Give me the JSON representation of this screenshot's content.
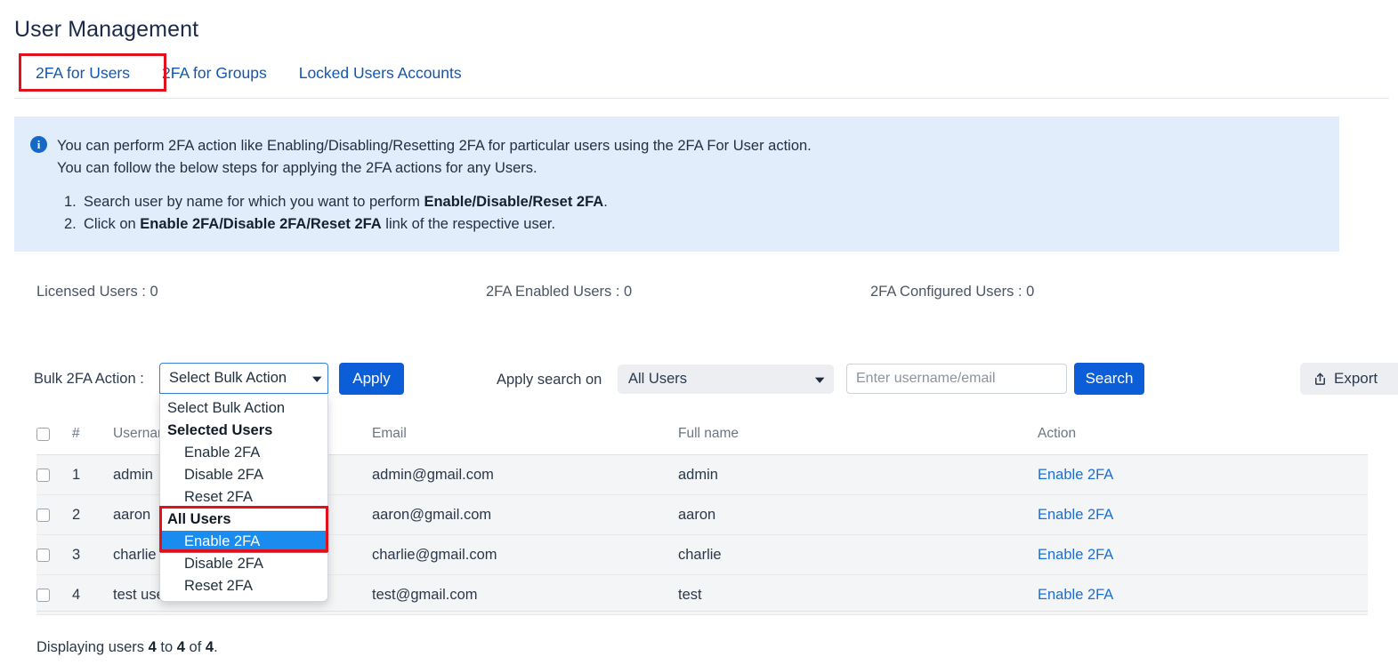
{
  "header": {
    "title": "User Management"
  },
  "tabs": [
    {
      "label": "2FA for Users",
      "active": true
    },
    {
      "label": "2FA for Groups",
      "active": false
    },
    {
      "label": "Locked Users Accounts",
      "active": false
    }
  ],
  "info_banner": {
    "icon": "info-circle-icon",
    "line1": "You can perform 2FA action like Enabling/Disabling/Resetting 2FA for particular users using the 2FA For User action.",
    "line2": "You can follow the below steps for applying the 2FA actions for any Users.",
    "step1_num": "1.",
    "step1_prefix": "Search user by name for which you want to perform ",
    "step1_bold": "Enable/Disable/Reset 2FA",
    "step1_suffix": ".",
    "step2_num": "2.",
    "step2_prefix": "Click on ",
    "step2_bold": "Enable 2FA/Disable 2FA/Reset 2FA",
    "step2_suffix": " link of the respective user."
  },
  "stats": {
    "licensed_users": "Licensed Users : 0",
    "enabled_users": "2FA Enabled Users : 0",
    "configured_users": "2FA Configured Users : 0"
  },
  "toolbar": {
    "bulk_label": "Bulk 2FA Action :",
    "bulk_select_value": "Select Bulk Action",
    "apply_label": "Apply",
    "search_on_label": "Apply search on",
    "search_on_value": "All Users",
    "search_placeholder": "Enter username/email",
    "search_value": "",
    "search_button_label": "Search",
    "export_label": "Export",
    "caret": "⌄"
  },
  "bulk_dropdown": {
    "open": true,
    "items": [
      {
        "label": "Select Bulk Action",
        "type": "option",
        "selected": false
      },
      {
        "label": "Selected Users",
        "type": "group",
        "selected": false
      },
      {
        "label": "Enable 2FA",
        "type": "option",
        "selected": false
      },
      {
        "label": "Disable 2FA",
        "type": "option",
        "selected": false
      },
      {
        "label": "Reset 2FA",
        "type": "option",
        "selected": false
      },
      {
        "label": "All Users",
        "type": "group",
        "selected": false
      },
      {
        "label": "Enable 2FA",
        "type": "option",
        "selected": true
      },
      {
        "label": "Disable 2FA",
        "type": "option",
        "selected": false
      },
      {
        "label": "Reset 2FA",
        "type": "option",
        "selected": false
      }
    ]
  },
  "table": {
    "columns": [
      "#",
      "Username",
      "Email",
      "Full name",
      "Action"
    ],
    "rows": [
      {
        "num": "1",
        "username": "admin",
        "email": "admin@gmail.com",
        "fullname": "admin",
        "action": "Enable 2FA"
      },
      {
        "num": "2",
        "username": "aaron",
        "email": "aaron@gmail.com",
        "fullname": "aaron",
        "action": "Enable 2FA"
      },
      {
        "num": "3",
        "username": "charlie",
        "email": "charlie@gmail.com",
        "fullname": "charlie",
        "action": "Enable 2FA"
      },
      {
        "num": "4",
        "username": "test user",
        "email": "test@gmail.com",
        "fullname": "test",
        "action": "Enable 2FA"
      }
    ]
  },
  "footer": {
    "displaying_prefix": "Displaying users ",
    "displaying_from": "4",
    "displaying_mid": " to ",
    "displaying_to": "4",
    "displaying_of": " of ",
    "displaying_total": "4",
    "displaying_suffix": "."
  },
  "colors": {
    "accent_blue": "#0b5ed7",
    "link_blue": "#1a6fd4",
    "highlight_red": "#e2101a",
    "selected_option_bg": "#1a8cf0",
    "banner_bg": "#e1edfb"
  }
}
